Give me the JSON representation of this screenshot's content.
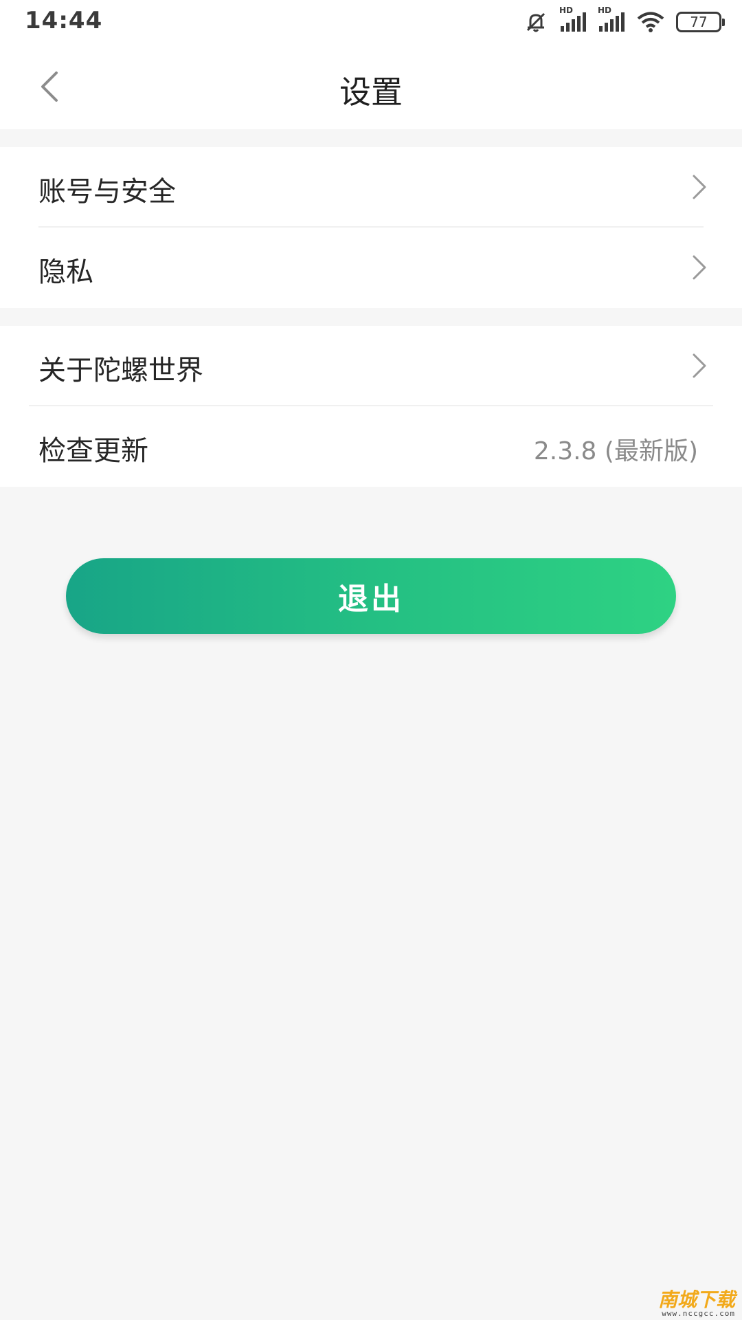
{
  "status_bar": {
    "time": "14:44",
    "network_1": "HD",
    "network_2": "HD",
    "battery": "77",
    "icons": [
      "bell-muted-icon",
      "signal-icon",
      "signal-icon",
      "wifi-icon",
      "battery-icon"
    ]
  },
  "header": {
    "title": "设置",
    "back_icon": "chevron-left-icon"
  },
  "groups": [
    {
      "items": [
        {
          "label": "账号与安全",
          "icon": "chevron-right-icon"
        },
        {
          "label": "隐私",
          "icon": "chevron-right-icon"
        }
      ]
    },
    {
      "items": [
        {
          "label": "关于陀螺世界",
          "icon": "chevron-right-icon"
        },
        {
          "label": "检查更新",
          "value": "2.3.8 (最新版)"
        }
      ]
    }
  ],
  "logout_label": "退出",
  "watermark": {
    "name": "南城下载",
    "url": "www.nccgcc.com"
  },
  "colors": {
    "button_gradient_start": "#18a587",
    "button_gradient_end": "#2ed283",
    "background": "#f6f6f6",
    "surface": "#ffffff",
    "secondary_text": "#8a8a8a"
  }
}
